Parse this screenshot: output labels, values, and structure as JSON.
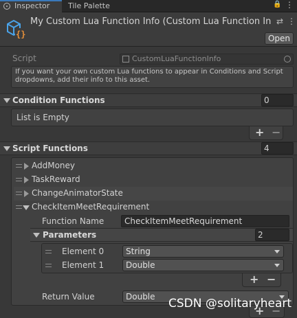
{
  "tabs": {
    "inspector": "Inspector",
    "tile_palette": "Tile Palette"
  },
  "header": {
    "title": "My Custom Lua Function Info (Custom Lua Function Info)",
    "open_label": "Open"
  },
  "script": {
    "label": "Script",
    "value": "CustomLuaFunctionInfo"
  },
  "help_text": "If you want your own custom Lua functions to appear in Conditions and Script dropdowns, add their info to this asset.",
  "condition_functions": {
    "label": "Condition Functions",
    "count": "0",
    "empty_text": "List is Empty",
    "add": "+",
    "remove": "−"
  },
  "script_functions": {
    "label": "Script Functions",
    "count": "4",
    "items": [
      {
        "name": "AddMoney"
      },
      {
        "name": "TaskReward"
      },
      {
        "name": "ChangeAnimatorState"
      },
      {
        "name": "CheckItemMeetRequirement"
      }
    ],
    "expanded": {
      "function_name_label": "Function Name",
      "function_name_value": "CheckItemMeetRequirement",
      "parameters_label": "Parameters",
      "parameters_count": "2",
      "parameters": [
        {
          "label": "Element 0",
          "value": "String"
        },
        {
          "label": "Element 1",
          "value": "Double"
        }
      ],
      "param_add": "+",
      "param_remove": "−",
      "return_value_label": "Return Value",
      "return_value": "Double"
    },
    "add": "+",
    "remove": "−"
  },
  "watermark": "CSDN @solitaryheart",
  "colors": {
    "panel_bg": "#383838",
    "tab_accent": "#3a79bb",
    "asset_icon_blue": "#4aa3e8",
    "asset_icon_orange": "#e8913a"
  },
  "icons": {
    "inspector_tab": "info-circle-icon",
    "lock": "lock-icon",
    "menu": "kebab-menu-icon",
    "asset": "scriptable-object-icon",
    "script_file": "script-file-icon",
    "object_picker": "object-picker-icon"
  }
}
